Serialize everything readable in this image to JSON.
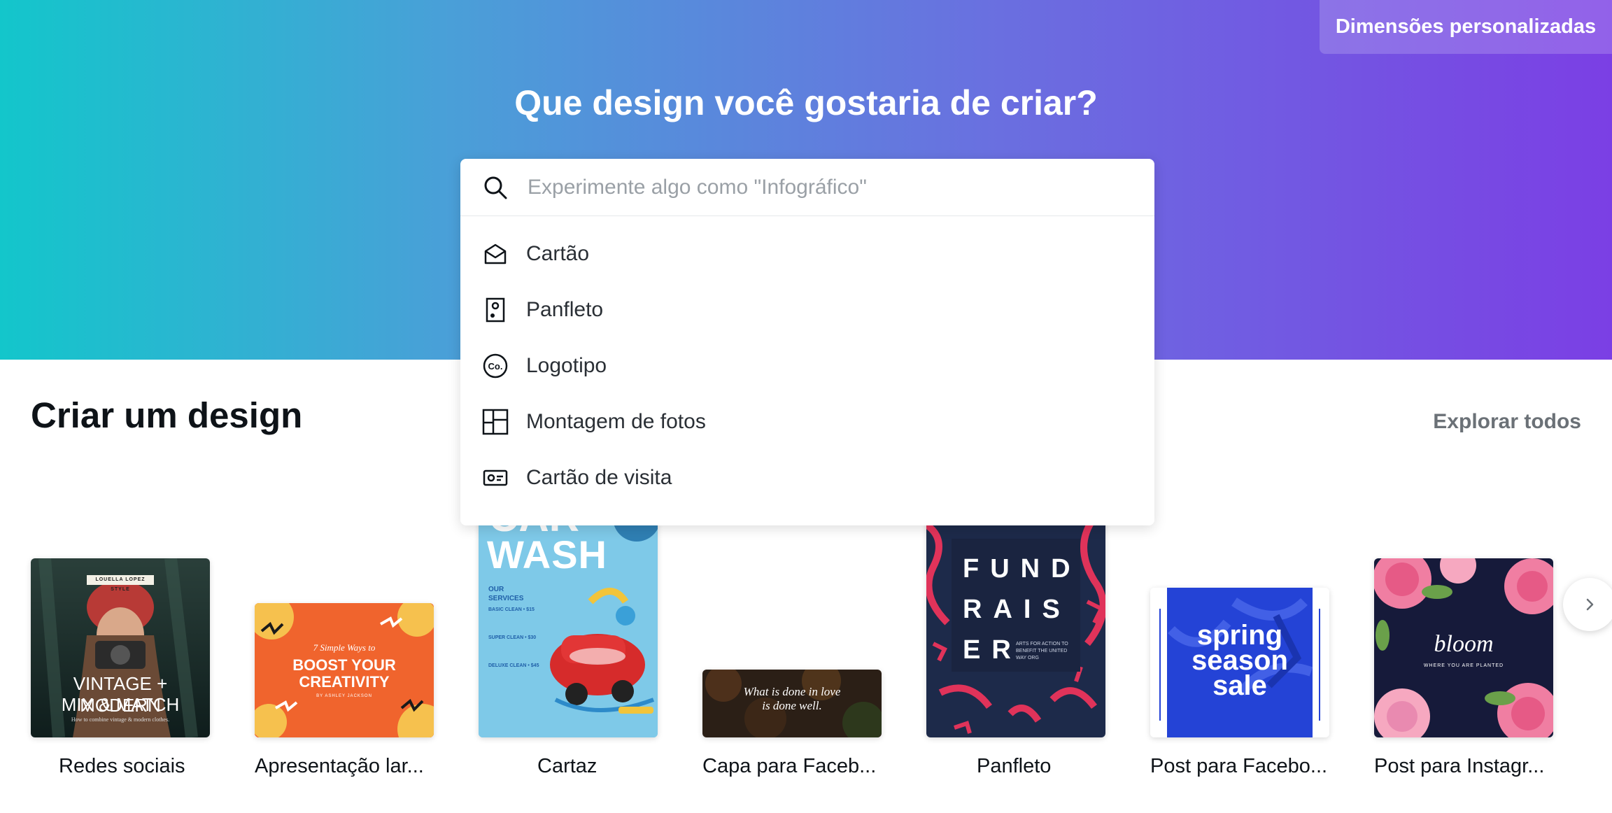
{
  "header": {
    "custom_dimensions_label": "Dimensões personalizadas",
    "title": "Que design você gostaria de criar?"
  },
  "search": {
    "placeholder": "Experimente algo como \"Infográfico\"",
    "value": "",
    "suggestions": [
      {
        "label": "Cartão",
        "icon": "card-envelope-icon"
      },
      {
        "label": "Panfleto",
        "icon": "flyer-icon"
      },
      {
        "label": "Logotipo",
        "icon": "logo-co-icon"
      },
      {
        "label": "Montagem de fotos",
        "icon": "photo-collage-icon"
      },
      {
        "label": "Cartão de visita",
        "icon": "business-card-icon"
      }
    ]
  },
  "section": {
    "title": "Criar um design",
    "explore_label": "Explorar todos"
  },
  "designs": [
    {
      "label": "Redes sociais",
      "thumb": {
        "line1": "LOUELLA LOPEZ STYLE",
        "line2": "VINTAGE + MODERN",
        "line3": "MIX & MATCH",
        "line4": "How to combine vintage & modern clothes."
      }
    },
    {
      "label": "Apresentação lar...",
      "thumb": {
        "line1": "7 Simple Ways to",
        "line2": "BOOST YOUR",
        "line3": "CREATIVITY",
        "line4": "BY ASHLEY JACKSON"
      }
    },
    {
      "label": "Cartaz",
      "thumb": {
        "line1": "CAR",
        "line2": "WASH",
        "line3": "OUR SERVICES",
        "line4": "BASIC CLEAN • $15",
        "line5": "SUPER CLEAN • $30",
        "line6": "DELUXE CLEAN • $45"
      }
    },
    {
      "label": "Capa para Faceb...",
      "thumb": {
        "line1": "What is done in love",
        "line2": "is done well."
      }
    },
    {
      "label": "Panfleto",
      "thumb": {
        "line1": "FUND",
        "line2": "RAIS",
        "line3": "ER",
        "line4": "ARTS FOR ACTION TO BENEFIT THE UNITED WAY ORG"
      }
    },
    {
      "label": "Post para Facebo...",
      "thumb": {
        "line1": "spring",
        "line2": "season",
        "line3": "sale"
      }
    },
    {
      "label": "Post para Instagr...",
      "thumb": {
        "line1": "bloom",
        "line2": "WHERE YOU ARE PLANTED"
      }
    }
  ],
  "colors": {
    "gradient_start": "#13c6cb",
    "gradient_end": "#7b3fe4",
    "text_dark": "#0e1318",
    "muted": "#6b7177"
  }
}
